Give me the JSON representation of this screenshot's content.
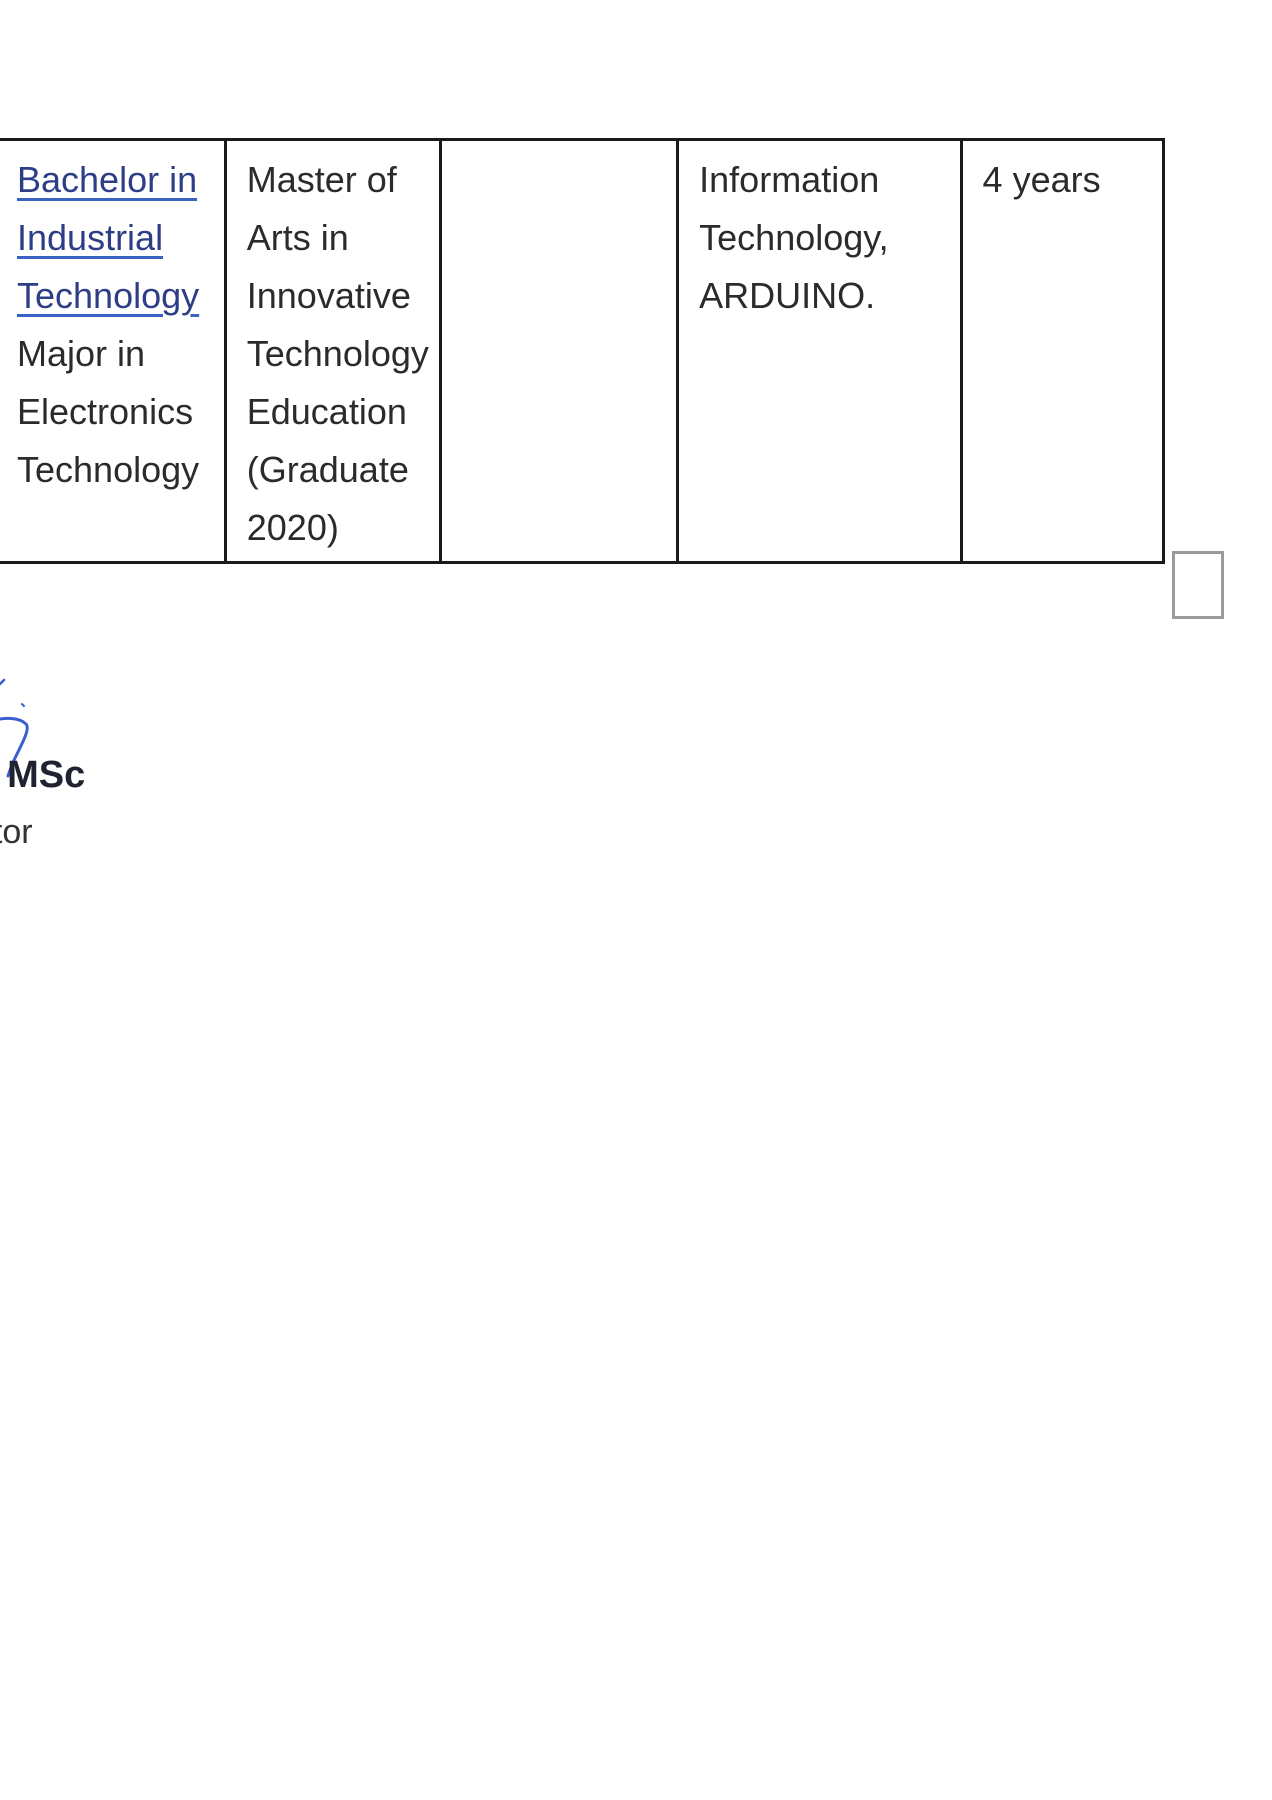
{
  "qualifications_table": {
    "row": {
      "bachelor": {
        "linked_lines": [
          "Bachelor in",
          "Industrial",
          "Technology"
        ],
        "lines": [
          "Major in",
          "Electronics",
          "Technology"
        ]
      },
      "master": {
        "lines": [
          "Master of",
          "Arts in",
          "Innovative",
          "Technology",
          "Education",
          "(Graduate",
          "2020)"
        ]
      },
      "empty_cell": "",
      "field": {
        "lines": [
          "Information",
          "Technology,",
          "ARDUINO."
        ]
      },
      "duration": "4 years"
    }
  },
  "signature_block": {
    "name_fragment": ", MSc",
    "title_fragment": "ator"
  },
  "colors": {
    "link_text": "#2e3e86",
    "link_underline": "#3a62c2",
    "signature_ink": "#3a5fd0",
    "table_border": "#1a1a1a"
  }
}
